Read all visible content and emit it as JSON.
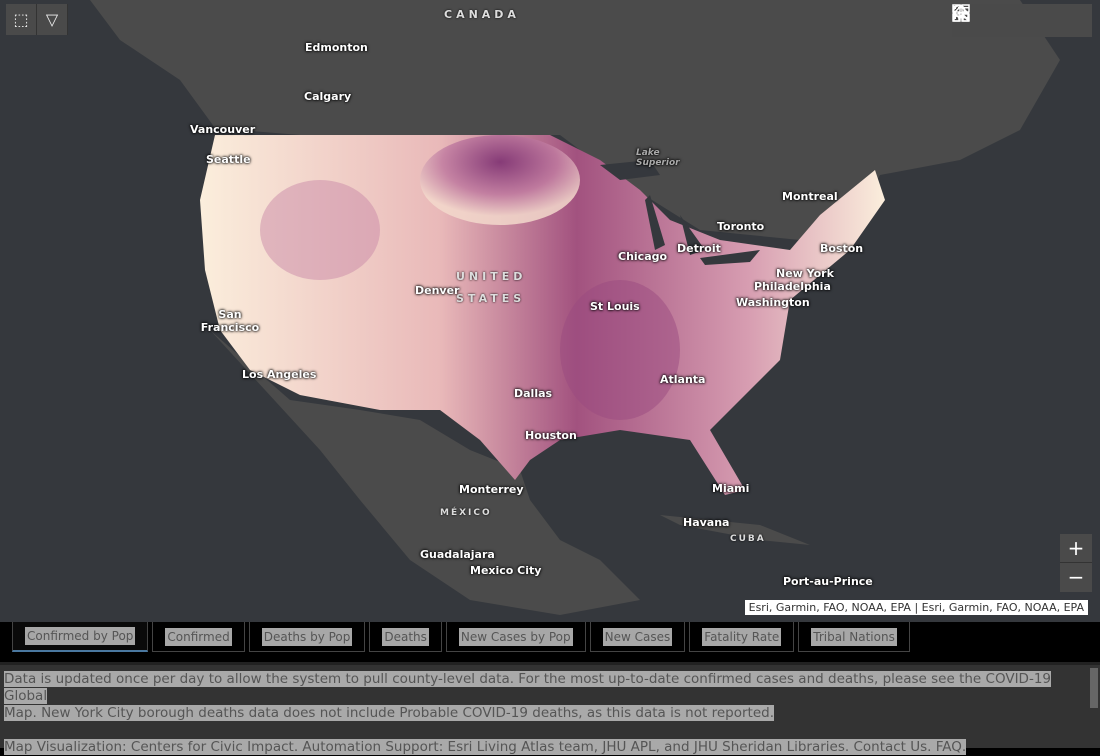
{
  "map": {
    "countries": [
      "CANADA",
      "UNITED STATES",
      "MÉXICO",
      "CUBA"
    ],
    "cities": [
      "Edmonton",
      "Calgary",
      "Vancouver",
      "Seattle",
      "San Francisco",
      "Los Angeles",
      "Denver",
      "Dallas",
      "Houston",
      "St Louis",
      "Chicago",
      "Detroit",
      "Toronto",
      "Montreal",
      "Boston",
      "New York",
      "Philadelphia",
      "Washington",
      "Atlanta",
      "Miami",
      "Havana",
      "Monterrey",
      "Guadalajara",
      "Mexico City",
      "Port-au-Prince"
    ],
    "water": [
      "Lake Superior"
    ],
    "attribution": "Esri, Garmin, FAO, NOAA, EPA | Esri, Garmin, FAO, NOAA, EPA",
    "zoom_in": "+",
    "zoom_out": "−",
    "colors": {
      "ocean": "#35383d",
      "land": "#4b4b4b",
      "low": "#fbeedc",
      "high": "#6e2466"
    }
  },
  "tabs": [
    "Confirmed by Pop",
    "Confirmed",
    "Deaths by Pop",
    "Deaths",
    "New Cases by Pop",
    "New Cases",
    "Fatality Rate",
    "Tribal Nations"
  ],
  "active_tab": "Confirmed by Pop",
  "info": {
    "line1": "Data is updated once per day to allow the system to pull county-level data. For the most up-to-date confirmed cases and deaths, please see the COVID-19 Global",
    "line2": "Map. New York City borough deaths data does not include Probable COVID-19 deaths, as this data is not reported.",
    "line3": "Map Visualization: Centers for Civic Impact. Automation Support: Esri Living Atlas team, JHU APL, and JHU Sheridan Libraries. Contact Us. FAQ."
  }
}
